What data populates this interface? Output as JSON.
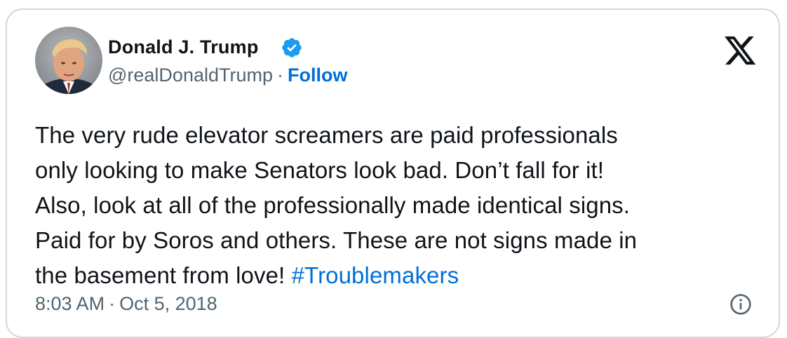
{
  "author": {
    "display_name": "Donald J. Trump",
    "handle": "@realDonaldTrump",
    "separator": "·",
    "follow_label": "Follow",
    "avatar_icon": "user-avatar-photo",
    "verified_icon": "verified-badge-icon",
    "verified_color": "#1d9bf0"
  },
  "platform_logo": "x-logo-icon",
  "tweet": {
    "lines": [
      "The very rude elevator screamers are paid professionals",
      "only looking to make Senators look bad. Don’t fall for it!",
      "Also, look at all of the professionally made identical signs.",
      "Paid for by Soros and others. These are not signs made in"
    ],
    "last_line_text": "the basement from love! ",
    "hashtag": "#Troublemakers"
  },
  "meta": {
    "time": "8:03 AM",
    "separator": "·",
    "date": "Oct 5, 2018",
    "info_icon": "info-icon"
  },
  "colors": {
    "text": "#0f1419",
    "secondary": "#536471",
    "link": "#006fd6",
    "border": "#cfd9de"
  }
}
